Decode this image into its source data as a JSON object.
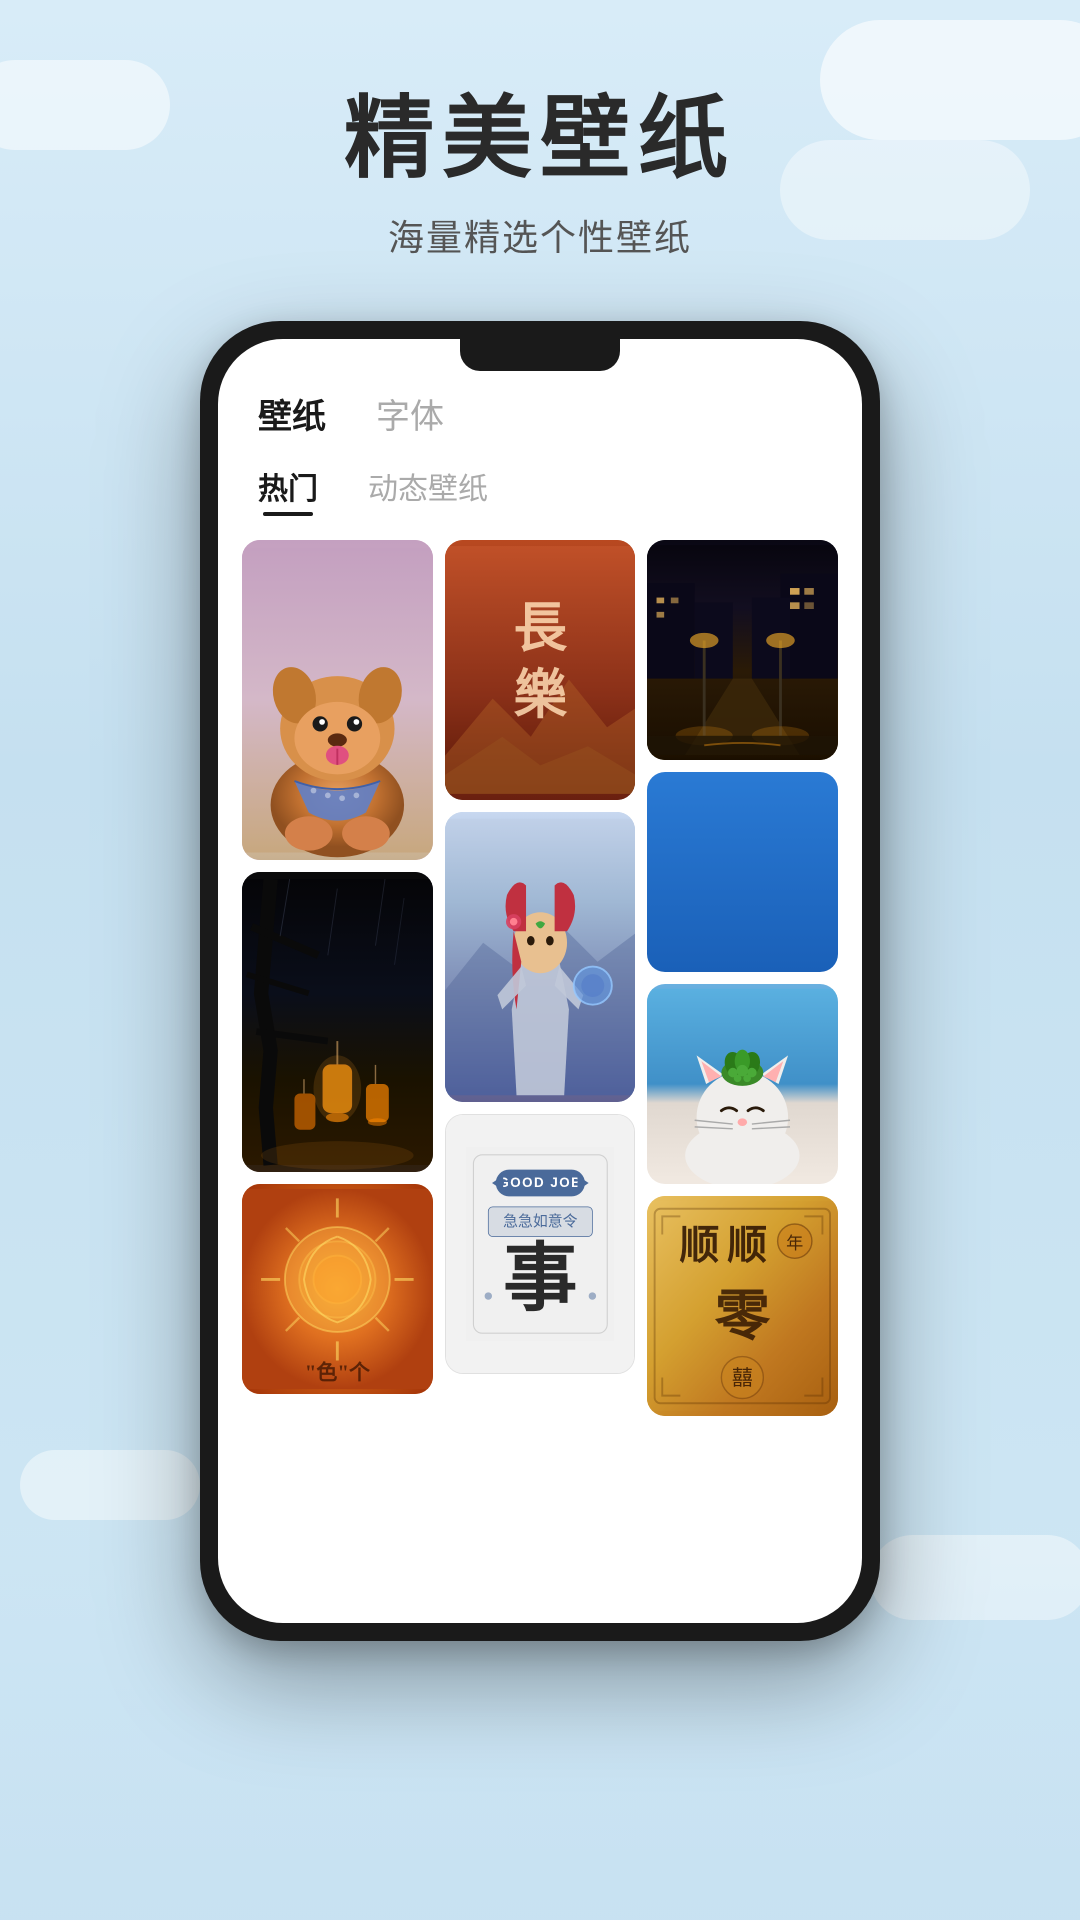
{
  "page": {
    "bg_color": "#c8dff0"
  },
  "header": {
    "main_title": "精美壁纸",
    "sub_title": "海量精选个性壁纸"
  },
  "phone": {
    "main_tabs": [
      {
        "id": "wallpaper",
        "label": "壁纸",
        "active": true
      },
      {
        "id": "font",
        "label": "字体",
        "active": false
      }
    ],
    "sub_tabs": [
      {
        "id": "hot",
        "label": "热门",
        "active": true
      },
      {
        "id": "dynamic",
        "label": "动态壁纸",
        "active": false
      }
    ]
  },
  "grid": {
    "col1": [
      {
        "id": "dog",
        "type": "image",
        "description": "Shiba Inu dog with blue bandana"
      },
      {
        "id": "lantern",
        "type": "image",
        "description": "Dark lantern night scene"
      },
      {
        "id": "orange-spiral",
        "type": "image",
        "description": "Orange spiral sun design",
        "bottom_text": "\"色\"个"
      }
    ],
    "col2": [
      {
        "id": "changele",
        "type": "text-card",
        "text": "長\n樂",
        "description": "Chinese calligraphy card rust red"
      },
      {
        "id": "anime",
        "type": "image",
        "description": "Anime character fantasy"
      },
      {
        "id": "goodjob",
        "type": "text-card",
        "badge": "GOOD JOB",
        "chinese_text": "急急如意令",
        "char": "事"
      }
    ],
    "col3": [
      {
        "id": "street",
        "type": "image",
        "description": "Night street city lights"
      },
      {
        "id": "blue-solid",
        "type": "solid",
        "description": "Plain blue wallpaper"
      },
      {
        "id": "cat",
        "type": "image",
        "description": "White cat with green plant on head"
      },
      {
        "id": "chinese-art",
        "type": "text-card",
        "text": "顺顺\n零",
        "description": "Chinese decorative golden card"
      }
    ]
  }
}
